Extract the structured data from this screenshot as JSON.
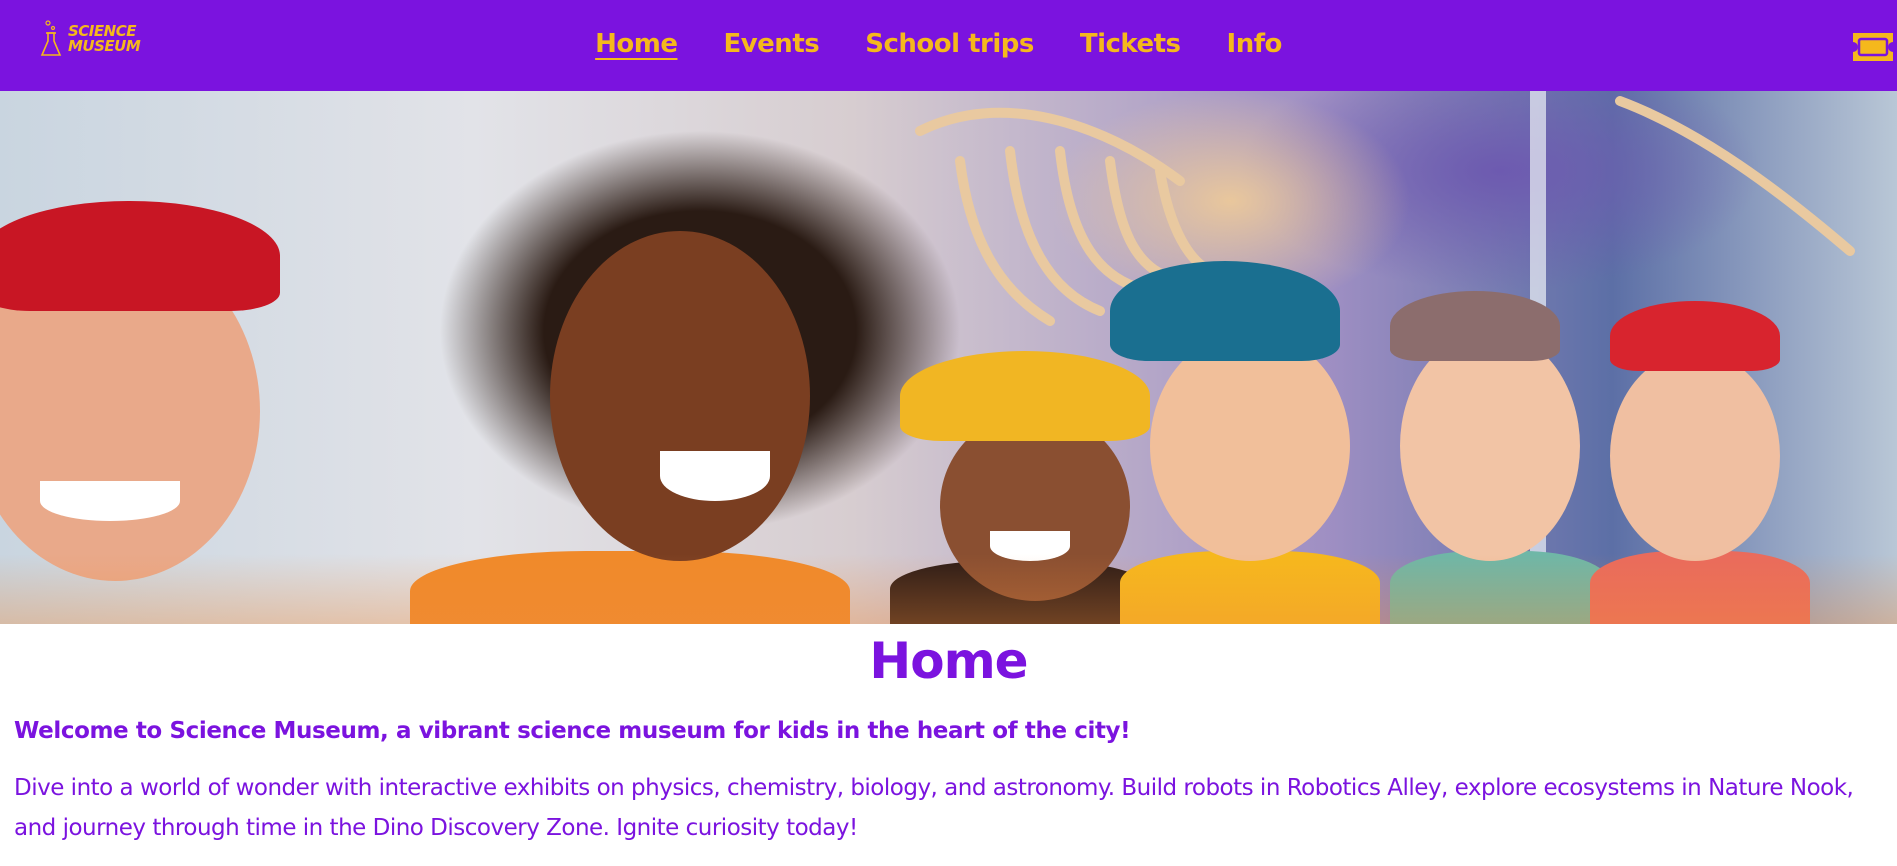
{
  "header": {
    "logo_line1": "SCIENCE",
    "logo_line2": "MUSEUM",
    "nav": [
      {
        "label": "Home",
        "active": true
      },
      {
        "label": "Events",
        "active": false
      },
      {
        "label": "School trips",
        "active": false
      },
      {
        "label": "Tickets",
        "active": false
      },
      {
        "label": "Info",
        "active": false
      }
    ],
    "ticket_icon": "ticket-icon"
  },
  "hero": {
    "image": "hero-photo-kids-at-museum"
  },
  "main": {
    "title": "Home",
    "welcome": "Welcome to Science Museum, a vibrant science museum for kids in the heart of the city!",
    "description": "Dive into a world of wonder with interactive exhibits on physics, chemistry, biology, and astronomy. Build robots in Robotics Alley, explore ecosystems in Nature Nook, and journey through time in the Dino Discovery Zone. Ignite curiosity today!"
  },
  "colors": {
    "brand_purple": "#7b13df",
    "accent_yellow": "#f5b81c"
  }
}
